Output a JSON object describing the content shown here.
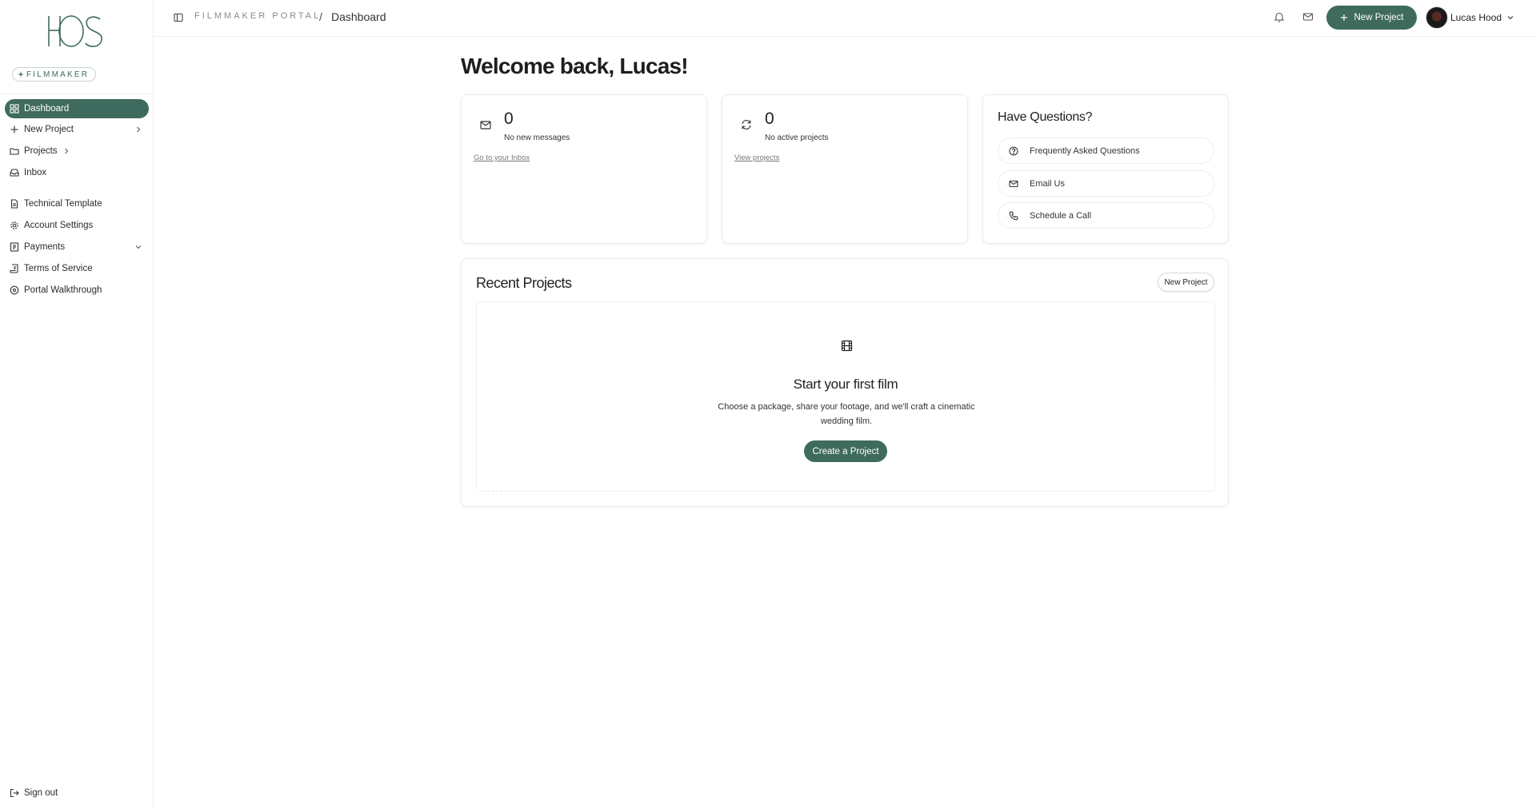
{
  "brand": {
    "logo_text": "HOS",
    "badge_label": "FILMMAKER"
  },
  "sidebar": {
    "items": [
      {
        "label": "Dashboard",
        "icon": "grid-icon"
      },
      {
        "label": "New Project",
        "icon": "plus-icon"
      },
      {
        "label": "Projects",
        "icon": "folder-icon"
      },
      {
        "label": "Inbox",
        "icon": "inbox-icon"
      },
      {
        "label": "Technical Template",
        "icon": "file-icon"
      },
      {
        "label": "Account Settings",
        "icon": "gear-icon"
      },
      {
        "label": "Payments",
        "icon": "receipt-icon"
      },
      {
        "label": "Terms of Service",
        "icon": "scroll-icon"
      },
      {
        "label": "Portal Walkthrough",
        "icon": "compass-icon"
      }
    ],
    "sign_out": "Sign out"
  },
  "topbar": {
    "portal": "FILMMAKER PORTAL",
    "separator": "/",
    "current": "Dashboard",
    "new_project": "New Project",
    "user_name": "Lucas Hood"
  },
  "main": {
    "welcome": "Welcome back, Lucas!",
    "stats": [
      {
        "value": "0",
        "label": "No new messages",
        "link": "Go to your Inbox",
        "icon": "mail-icon"
      },
      {
        "value": "0",
        "label": "No active projects",
        "link": "View projects",
        "icon": "refresh-icon"
      }
    ],
    "questions": {
      "title": "Have Questions?",
      "items": [
        {
          "label": "Frequently Asked Questions",
          "icon": "help-circle-icon"
        },
        {
          "label": "Email Us",
          "icon": "mail-icon"
        },
        {
          "label": "Schedule a Call",
          "icon": "phone-icon"
        }
      ]
    },
    "recent_projects": {
      "title": "Recent Projects",
      "new_button": "New Project",
      "empty_title": "Start your first film",
      "empty_desc": "Choose a package, share your footage, and we'll craft a cinematic wedding film.",
      "create_button": "Create a Project"
    }
  },
  "colors": {
    "accent": "#3e6b5d",
    "border": "#ebebeb"
  }
}
